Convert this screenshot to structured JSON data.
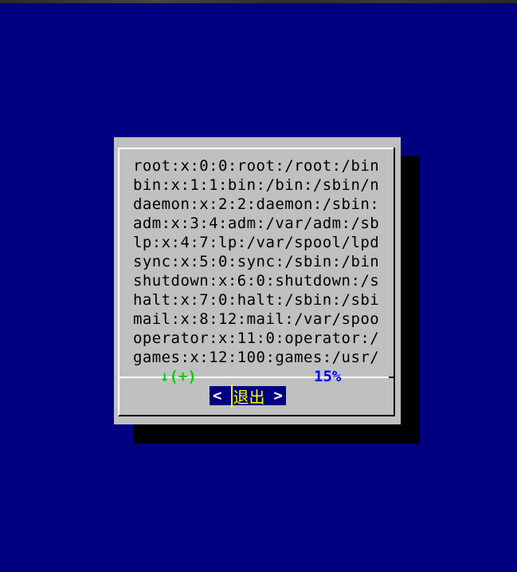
{
  "textbox": {
    "lines": [
      "root:x:0:0:root:/root:/bin",
      "bin:x:1:1:bin:/bin:/sbin/n",
      "daemon:x:2:2:daemon:/sbin:",
      "adm:x:3:4:adm:/var/adm:/sb",
      "lp:x:4:7:lp:/var/spool/lpd",
      "sync:x:5:0:sync:/sbin:/bin",
      "shutdown:x:6:0:shutdown:/s",
      "halt:x:7:0:halt:/sbin:/sbi",
      "mail:x:8:12:mail:/var/spoo",
      "operator:x:11:0:operator:/",
      "games:x:12:100:games:/usr/"
    ],
    "more_indicator": "↓(+)",
    "scroll_percent": "15%"
  },
  "buttons": {
    "exit": {
      "left_bracket": "<",
      "label": "退出",
      "right_bracket": ">"
    }
  },
  "colors": {
    "background": "#000080",
    "dialog": "#c0c0c0",
    "more_indicator": "#00d000",
    "percent": "#0000ff",
    "button_bg": "#000080",
    "button_label": "#ffff00"
  }
}
